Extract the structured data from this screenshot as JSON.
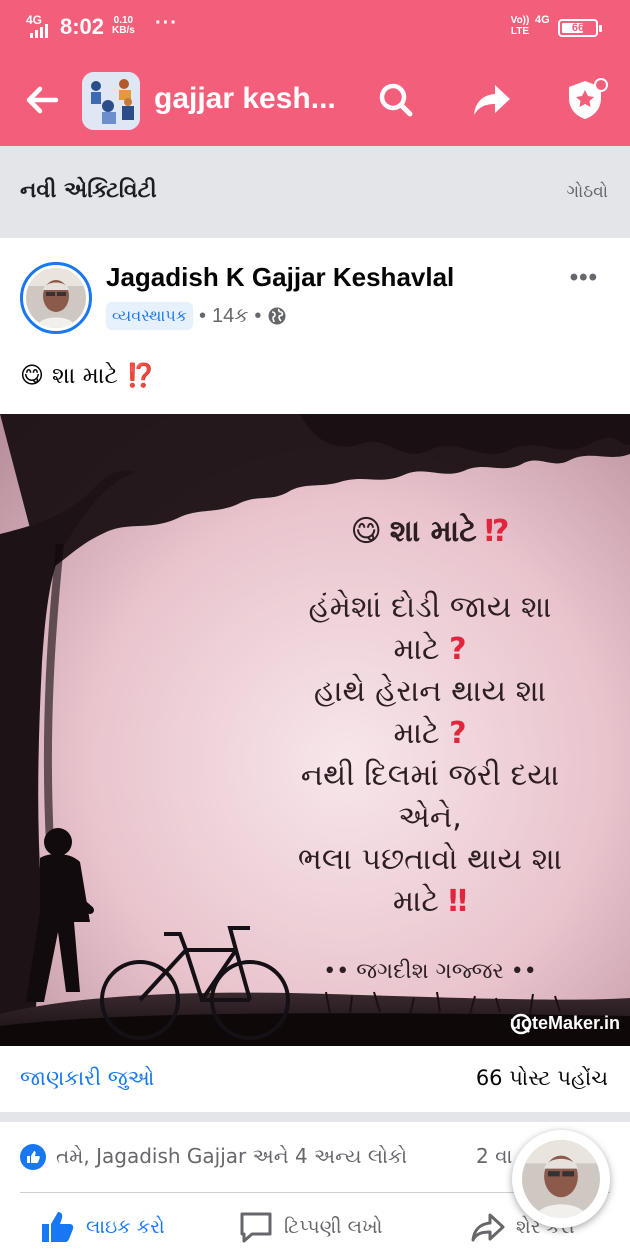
{
  "status_bar": {
    "network": "4G",
    "time": "8:02",
    "speed_value": "0.10",
    "speed_unit": "KB/s",
    "more": "···",
    "volte": "Vo)) LTE",
    "net_type": "4G",
    "battery_level": "66",
    "battery_fraction": 0.66
  },
  "app_bar": {
    "group_name": "gajjar kesh..."
  },
  "activity": {
    "title": "નવી એક્ટિવિટી",
    "arrange": "ગોઠવો"
  },
  "post": {
    "author": "Jagadish K Gajjar Keshavlal",
    "role_badge": "વ્યવસ્થાપક",
    "age": "14ક",
    "text": "શા માટે",
    "text_emoji": "😋",
    "text_mark": "⁉️"
  },
  "quote": {
    "title": "શા માટે",
    "title_mark": "⁉",
    "lines": [
      "હંમેશાં દોડી જાય શા",
      "માટે",
      "હાથે હેરાન થાય શા",
      "માટે",
      "નથી દિલમાં જરી દયા",
      "એને,",
      "ભલા પછતાવો થાય શા",
      "માટે"
    ],
    "q_mark": "?",
    "double_bang": "‼",
    "signature": "•• જગદીશ ગજ્જર ••",
    "watermark": "uoteMaker.in"
  },
  "info": {
    "view_info": "જાણકારી જુઓ",
    "reach": "66 પોસ્ટ પહોંચ"
  },
  "reactions": {
    "who": "તમે, Jagadish Gajjar અને 4 અન્ય લોકો",
    "shares": "2 વા"
  },
  "actions": {
    "like": "લાઇક કરો",
    "comment": "ટિપ્પણી લખો",
    "share": "શેર કરો"
  },
  "colors": {
    "brand": "#f35f7a",
    "link": "#1877f2",
    "accent_red": "#e0263c"
  }
}
